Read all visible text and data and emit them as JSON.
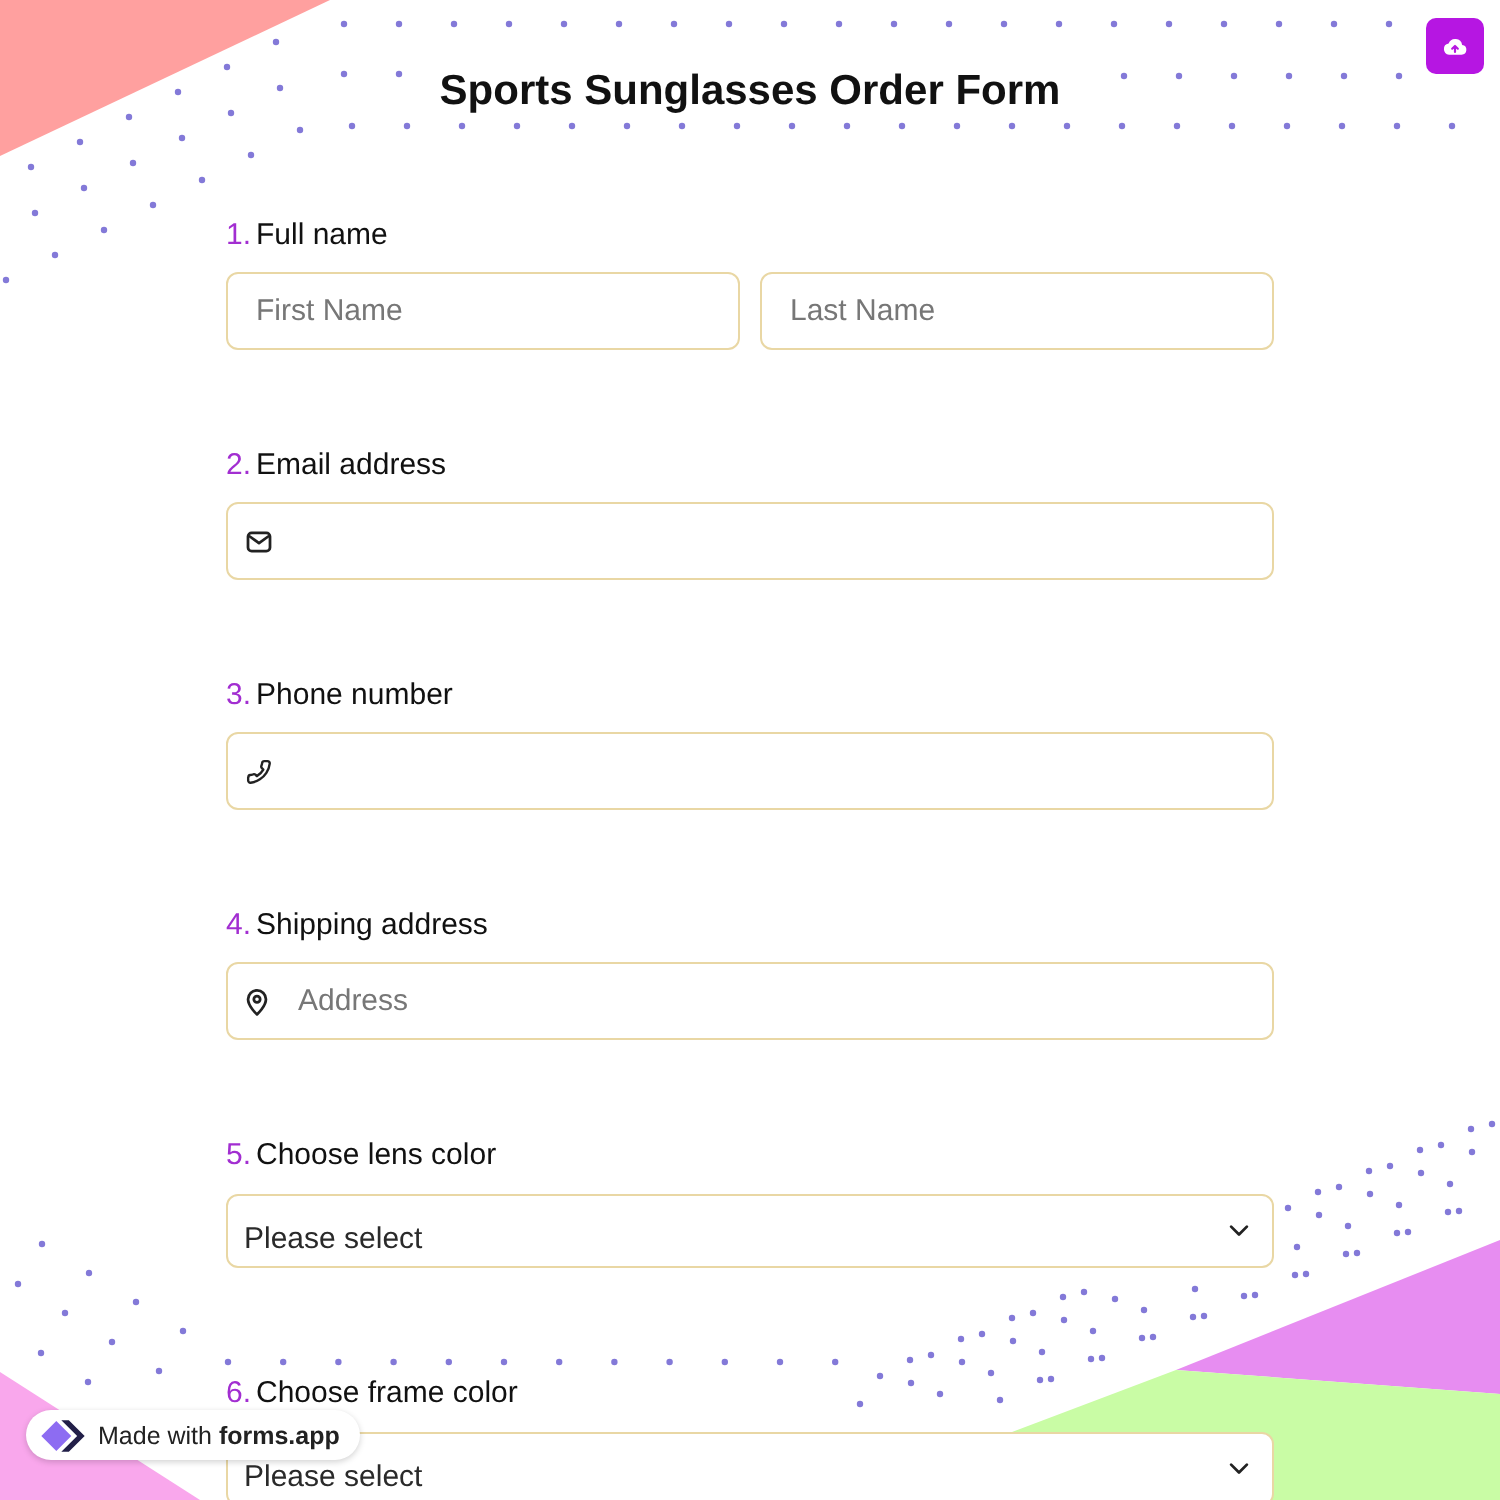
{
  "title": "Sports Sunglasses Order Form",
  "questions": [
    {
      "number": "1.",
      "label": "Full name",
      "kind": "name",
      "fields": [
        {
          "placeholder": "First Name"
        },
        {
          "placeholder": "Last Name"
        }
      ]
    },
    {
      "number": "2.",
      "label": "Email address",
      "kind": "email"
    },
    {
      "number": "3.",
      "label": "Phone number",
      "kind": "phone"
    },
    {
      "number": "4.",
      "label": "Shipping address",
      "kind": "address",
      "placeholder": "Address"
    },
    {
      "number": "5.",
      "label": "Choose lens color",
      "kind": "dropdown",
      "placeholder": "Please select"
    },
    {
      "number": "6.",
      "label": "Choose frame color",
      "kind": "dropdown",
      "placeholder": "Please select"
    }
  ],
  "badge": {
    "text": "Made with **forms.app**"
  }
}
